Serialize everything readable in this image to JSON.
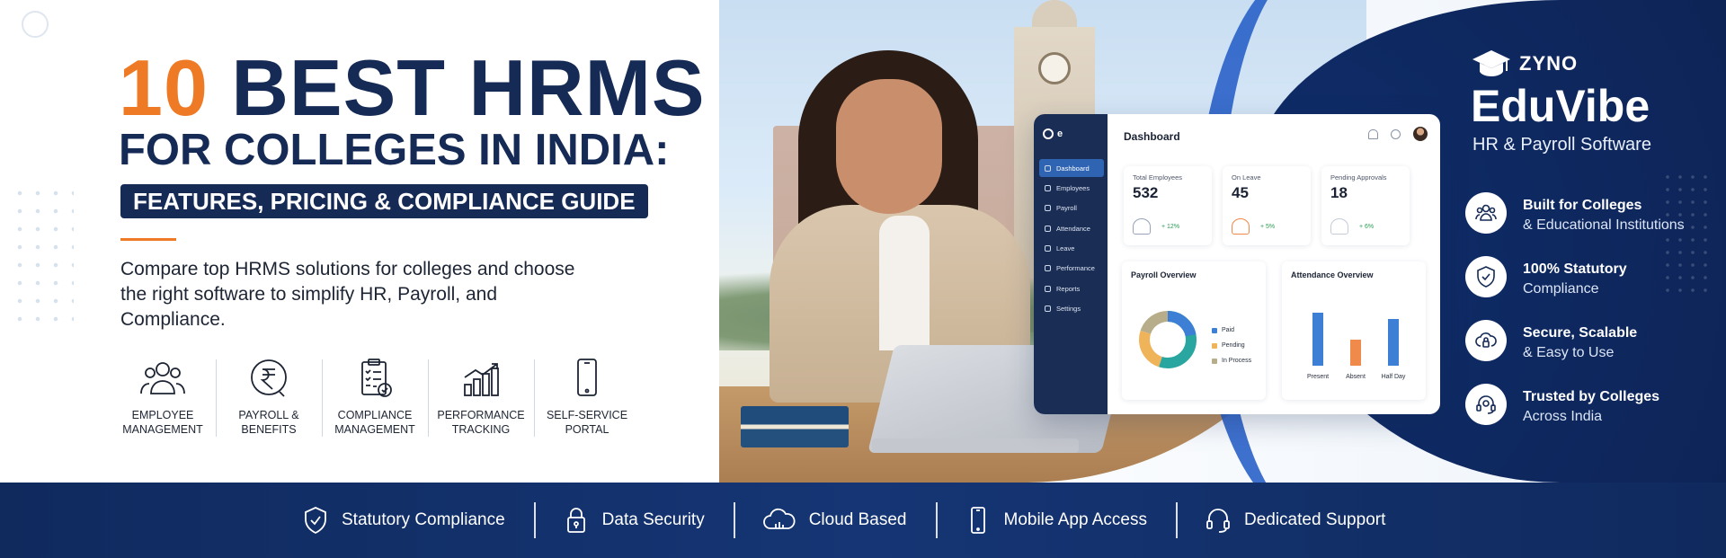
{
  "headline": {
    "number": "10",
    "line1_rest": "BEST HRMS",
    "line2": "FOR COLLEGES IN INDIA:",
    "pill": "FEATURES, PRICING & COMPLIANCE GUIDE",
    "intro": "Compare top HRMS solutions for colleges and choose the right software to simplify HR, Payroll, and Compliance."
  },
  "features": [
    {
      "icon": "people-icon",
      "label": "EMPLOYEE\nMANAGEMENT"
    },
    {
      "icon": "rupee-icon",
      "label": "PAYROLL &\nBENEFITS"
    },
    {
      "icon": "clipboard-check-icon",
      "label": "COMPLIANCE\nMANAGEMENT"
    },
    {
      "icon": "growth-chart-icon",
      "label": "PERFORMANCE\nTRACKING"
    },
    {
      "icon": "mobile-icon",
      "label": "SELF-SERVICE\nPORTAL"
    }
  ],
  "dashboard": {
    "title": "Dashboard",
    "nav": [
      "Dashboard",
      "Employees",
      "Payroll",
      "Attendance",
      "Leave",
      "Performance",
      "Reports",
      "Settings"
    ],
    "active_nav": "Dashboard",
    "stats": [
      {
        "label": "Total Employees",
        "value": "532",
        "delta": "+ 12%"
      },
      {
        "label": "On Leave",
        "value": "45",
        "delta": "+ 5%"
      },
      {
        "label": "Pending Approvals",
        "value": "18",
        "delta": "+ 6%"
      }
    ],
    "payroll_title": "Payroll Overview",
    "payroll_legend": [
      "Paid",
      "Pending",
      "In Process"
    ],
    "attendance_title": "Attendance Overview",
    "attendance_labels": [
      "Present",
      "Absent",
      "Half Day"
    ]
  },
  "brand": {
    "company": "ZYNO",
    "product": "EduVibe",
    "tagline": "HR & Payroll Software"
  },
  "benefits": [
    {
      "icon": "people-icon",
      "title": "Built for Colleges",
      "subtitle": "& Educational Institutions"
    },
    {
      "icon": "shield-check-icon",
      "title": "100% Statutory",
      "subtitle": "Compliance"
    },
    {
      "icon": "cloud-lock-icon",
      "title": "Secure, Scalable",
      "subtitle": "& Easy to Use"
    },
    {
      "icon": "headset-icon",
      "title": "Trusted by Colleges",
      "subtitle": "Across India"
    }
  ],
  "bottom_bar": [
    {
      "icon": "shield-check-icon",
      "label": "Statutory Compliance"
    },
    {
      "icon": "lock-icon",
      "label": "Data Security"
    },
    {
      "icon": "cloud-icon",
      "label": "Cloud Based"
    },
    {
      "icon": "mobile-icon",
      "label": "Mobile App Access"
    },
    {
      "icon": "headset-icon",
      "label": "Dedicated Support"
    }
  ],
  "colors": {
    "navy": "#152a55",
    "orange": "#ee7a25",
    "accent_blue": "#2f64b3",
    "bar_blue": "#3d7fd4",
    "bar_orange": "#ef8a4a"
  },
  "chart_data": [
    {
      "type": "pie",
      "title": "Payroll Overview",
      "categories": [
        "Paid",
        "Pending",
        "In Process"
      ],
      "values": [
        55,
        25,
        20
      ]
    },
    {
      "type": "bar",
      "title": "Attendance Overview",
      "categories": [
        "Present",
        "Absent",
        "Half Day"
      ],
      "values": [
        85,
        42,
        75
      ]
    }
  ]
}
